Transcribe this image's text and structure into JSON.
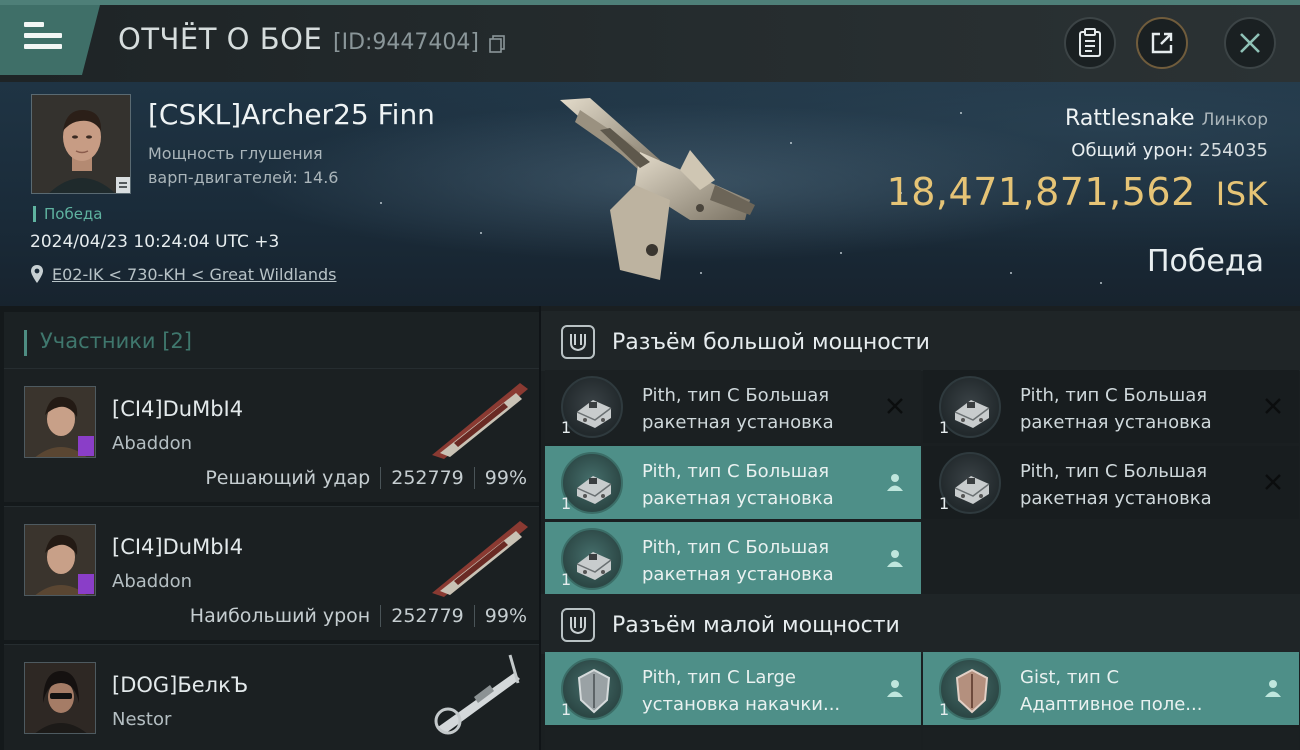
{
  "header": {
    "title": "ОТЧЁТ О БОЕ",
    "report_id": "[ID:9447404]",
    "buttons": [
      "clipboard-icon",
      "share-icon",
      "close-icon"
    ]
  },
  "victim": {
    "name": "[CSKL]Archer25 Finn",
    "stat_label_line1": "Мощность глушения",
    "stat_label_line2": "варп-двигателей: 14.6",
    "outcome_tag": "Победа",
    "datetime": "2024/04/23 10:24:04 UTC +3",
    "location": "E02-IK < 730-KH < Great Wildlands",
    "ship_name": "Rattlesnake",
    "ship_class": "Линкор",
    "total_damage_label": "Общий урон:",
    "total_damage": "254035",
    "isk_value": "18,471,871,562",
    "isk_unit": "ISK",
    "result": "Победа"
  },
  "participants": {
    "header": "Участники [2]",
    "rows": [
      {
        "name": "[CI4]DuMbI4",
        "ship": "Abaddon",
        "role": "Решающий удар",
        "damage": "252779",
        "percent": "99%"
      },
      {
        "name": "[CI4]DuMbI4",
        "ship": "Abaddon",
        "role": "Наибольший урон",
        "damage": "252779",
        "percent": "99%"
      },
      {
        "name": "[DOG]БелкЪ",
        "ship": "Nestor",
        "role": "",
        "damage": "",
        "percent": ""
      }
    ]
  },
  "fitting": {
    "high_slot_title": "Разъём большой мощности",
    "low_slot_title": "Разъём малой мощности",
    "high_slots": [
      {
        "line1": "Pith, тип C Большая",
        "line2": "ракетная установка",
        "qty": "1",
        "state": "destroyed-x-icon"
      },
      {
        "line1": "Pith, тип C Большая",
        "line2": "ракетная установка",
        "qty": "1",
        "state": "destroyed-x-icon"
      },
      {
        "line1": "Pith, тип C Большая",
        "line2": "ракетная установка",
        "qty": "1",
        "state": "dropped-person-icon"
      },
      {
        "line1": "Pith, тип C Большая",
        "line2": "ракетная установка",
        "qty": "1",
        "state": "destroyed-x-icon"
      },
      {
        "line1": "Pith, тип C Большая",
        "line2": "ракетная установка",
        "qty": "1",
        "state": "dropped-person-icon"
      }
    ],
    "low_slots": [
      {
        "line1": "Pith, тип C Large",
        "line2": "установка накачки...",
        "qty": "1",
        "state": "dropped-person-icon"
      },
      {
        "line1": "Gist, тип C",
        "line2": "Адаптивное поле...",
        "qty": "1",
        "state": "dropped-person-icon"
      }
    ]
  }
}
